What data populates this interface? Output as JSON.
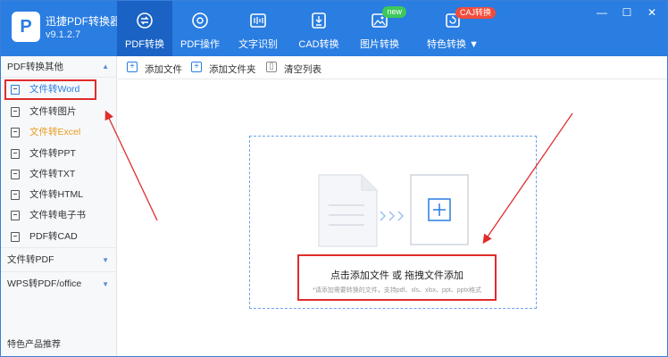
{
  "app": {
    "name": "迅捷PDF转换器",
    "version": "v9.1.2.7",
    "logo_letter": "P"
  },
  "nav": {
    "tabs": [
      {
        "label": "PDF转换",
        "icon": "convert-icon",
        "active": true
      },
      {
        "label": "PDF操作",
        "icon": "operate-icon",
        "active": false
      },
      {
        "label": "文字识别",
        "icon": "ocr-icon",
        "active": false
      },
      {
        "label": "CAD转换",
        "icon": "cad-icon",
        "active": false
      },
      {
        "label": "图片转换",
        "icon": "image-icon",
        "active": false,
        "badge": "new"
      },
      {
        "label": "特色转换 ▼",
        "icon": "special-icon",
        "active": false,
        "badge": "CAJ转换"
      }
    ]
  },
  "window": {
    "minimize": "—",
    "restore": "☐",
    "close": "✕"
  },
  "sidebar": {
    "section_title": "PDF转换其他",
    "items": [
      {
        "label": "文件转Word",
        "selected": true
      },
      {
        "label": "文件转图片"
      },
      {
        "label": "文件转Excel",
        "highlight": true
      },
      {
        "label": "文件转PPT"
      },
      {
        "label": "文件转TXT"
      },
      {
        "label": "文件转HTML"
      },
      {
        "label": "文件转电子书"
      },
      {
        "label": "PDF转CAD"
      }
    ],
    "groups": [
      {
        "label": "文件转PDF"
      },
      {
        "label": "WPS转PDF/office"
      }
    ],
    "footer": "特色产品推荐"
  },
  "toolbar": {
    "add_file": "添加文件",
    "add_folder": "添加文件夹",
    "clear_list": "清空列表"
  },
  "dropzone": {
    "title": "点击添加文件 或 拖拽文件添加",
    "subtitle": "*请添加需要转换的文件，支持pdf、xls、xlsx、ppt、pptx格式"
  },
  "colors": {
    "brand": "#2a7de1",
    "annotation": "#e02c2c",
    "highlight": "#e99a1c"
  }
}
